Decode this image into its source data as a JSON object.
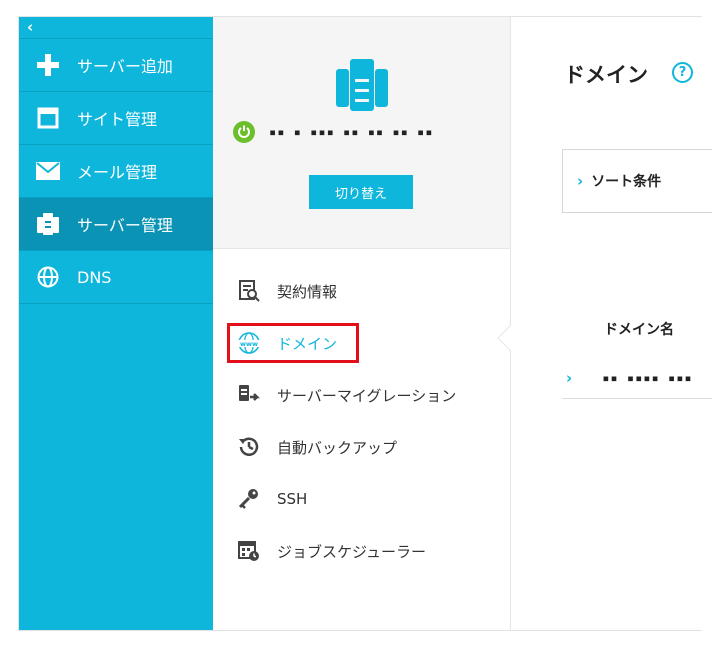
{
  "sidebar": {
    "collapse_icon": "chevron-left-icon",
    "items": [
      {
        "label": "サーバー追加",
        "icon": "plus-icon"
      },
      {
        "label": "サイト管理",
        "icon": "window-icon"
      },
      {
        "label": "メール管理",
        "icon": "envelope-icon"
      },
      {
        "label": "サーバー管理",
        "icon": "server-icon",
        "active": true
      },
      {
        "label": "DNS",
        "icon": "globe-icon"
      }
    ]
  },
  "server": {
    "name_masked": "▪▪ ▪ ▪▪▪ ▪▪ ▪▪ ▪▪ ▪▪",
    "status_icon": "power-icon",
    "switch_label": "切り替え"
  },
  "menu": {
    "items": [
      {
        "label": "契約情報",
        "icon": "contract-search-icon"
      },
      {
        "label": "ドメイン",
        "icon": "www-globe-icon",
        "selected": true
      },
      {
        "label": "サーバーマイグレーション",
        "icon": "server-migration-icon"
      },
      {
        "label": "自動バックアップ",
        "icon": "backup-clock-icon"
      },
      {
        "label": "SSH",
        "icon": "key-icon"
      },
      {
        "label": "ジョブスケジューラー",
        "icon": "calendar-clock-icon"
      }
    ]
  },
  "main": {
    "title": "ドメイン",
    "help_icon": "?",
    "sort_label": "ソート条件",
    "column_header": "ドメイン名",
    "rows": [
      {
        "domain_masked": "▪▪ ▪▪▪▪ ▪▪▪"
      }
    ]
  },
  "colors": {
    "accent": "#0fb6dc",
    "sidebar_active": "#0a93b4",
    "highlight": "#e3101b",
    "power": "#6abf2a"
  }
}
